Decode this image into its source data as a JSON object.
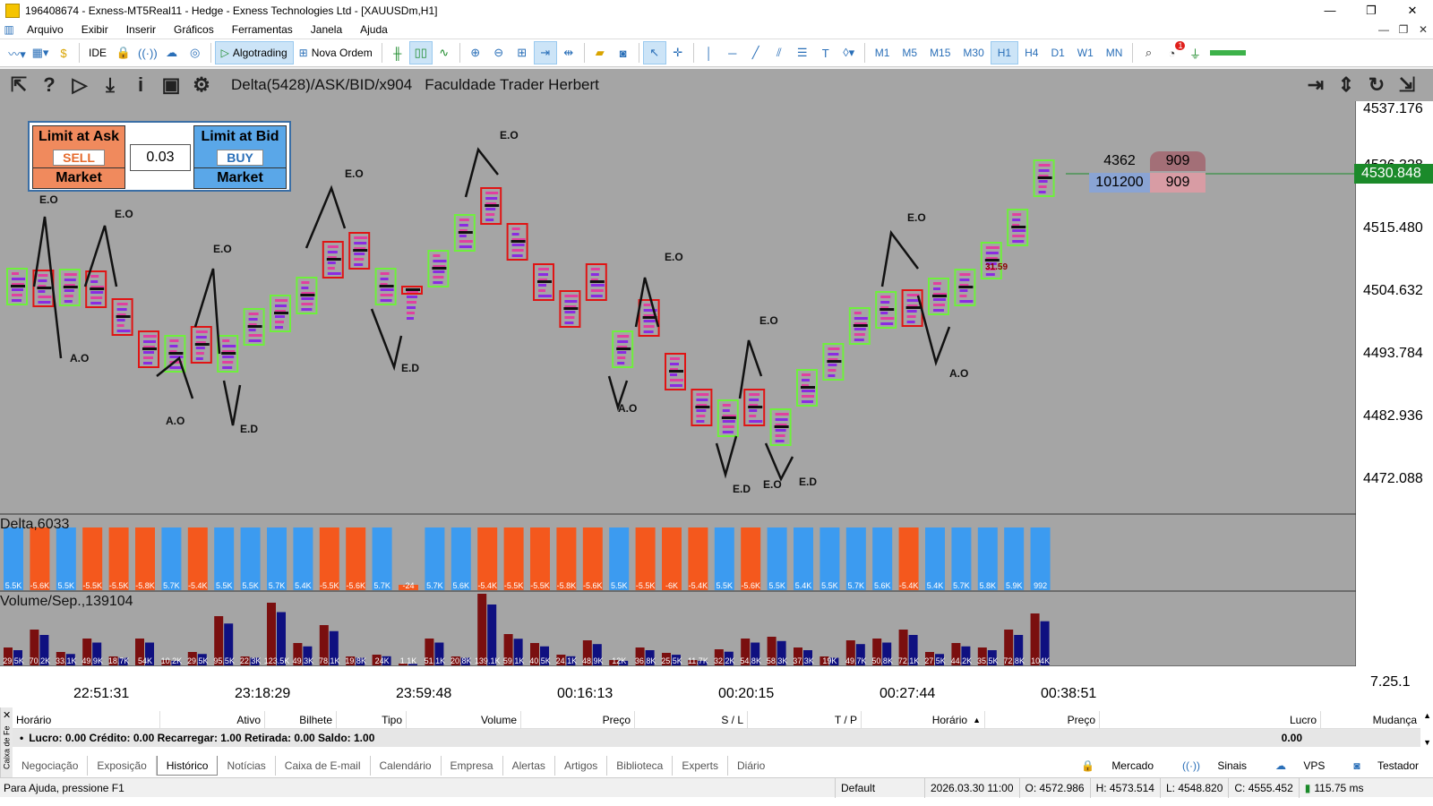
{
  "window": {
    "title": "196408674 - Exness-MT5Real11 - Hedge - Exness Technologies Ltd - [XAUUSDm,H1]",
    "controls": [
      "—",
      "❐",
      "✕"
    ]
  },
  "menu": {
    "items": [
      "Arquivo",
      "Exibir",
      "Inserir",
      "Gráficos",
      "Ferramentas",
      "Janela",
      "Ajuda"
    ]
  },
  "toolbar": {
    "ide": "IDE",
    "algotrading": "Algotrading",
    "nova_ordem": "Nova Ordem",
    "timeframes": [
      "M1",
      "M5",
      "M15",
      "M30",
      "H1",
      "H4",
      "D1",
      "W1",
      "MN"
    ],
    "active_timeframe": "H1",
    "notification_count": "1"
  },
  "chart": {
    "indicator_label": "Delta(5428)/ASK/BID/x904",
    "channel_label": "Faculdade Trader Herbert",
    "trade_panel": {
      "limit_ask": "Limit at Ask",
      "sell": "SELL",
      "market_left": "Market",
      "lot": "0.03",
      "limit_bid": "Limit at Bid",
      "buy": "BUY",
      "market_right": "Market"
    },
    "price_levels": [
      "4537.176",
      "4526.328",
      "4515.480",
      "4504.632",
      "4493.784",
      "4482.936",
      "4472.088"
    ],
    "current_price": "4530.848",
    "volume_info": {
      "top_left": "4362",
      "top_right": "909",
      "bottom_left": "101200",
      "bottom_right": "909"
    },
    "time_labels": [
      "22:51:31",
      "23:18:29",
      "23:59:48",
      "00:16:13",
      "00:20:15",
      "00:27:44",
      "00:38:51"
    ],
    "annotation_value": "31.59",
    "pattern_labels": [
      "E.O",
      "A.O",
      "E.D"
    ],
    "delta_panel_label": "Delta,6033",
    "volume_panel_label": "Volume/Sep.,139104",
    "volume_axis_value": "7.25.1",
    "delta_values": [
      "5.5K",
      "-5.6K",
      "5.5K",
      "-5.5K",
      "-5.5K",
      "-5.8K",
      "5.7K",
      "-5.4K",
      "5.5K",
      "5.5K",
      "5.7K",
      "5.4K",
      "-5.5K",
      "-5.6K",
      "5.7K",
      "-24",
      "5.7K",
      "5.6K",
      "-5.4K",
      "-5.5K",
      "-5.5K",
      "-5.8K",
      "-5.6K",
      "5.5K",
      "-5.5K",
      "-6K",
      "-5.4K",
      "5.5K",
      "-5.6K",
      "5.5K",
      "5.4K",
      "5.5K",
      "5.7K",
      "5.6K",
      "-5.4K",
      "5.4K",
      "5.7K",
      "5.8K",
      "5.9K",
      "992"
    ],
    "volume_values": [
      "29.5K",
      "70.2K",
      "33.1K",
      "49.9K",
      "18.7K",
      "54K",
      "10.2K",
      "29.5K",
      "95.5K",
      "22.3K",
      "123.5K",
      "49.3K",
      "78.1K",
      "19.8K",
      "24K",
      "1.1K",
      "51.1K",
      "20.8K",
      "139.1K",
      "59.1K",
      "40.5K",
      "24.1K",
      "48.9K",
      "12K",
      "36.8K",
      "25.5K",
      "11.7K",
      "32.2K",
      "54.8K",
      "58.3K",
      "37.3K",
      "19K",
      "49.7K",
      "50.8K",
      "72.1K",
      "27.5K",
      "44.2K",
      "35.5K",
      "72.8K",
      "104K"
    ]
  },
  "toolbox": {
    "side_label": "Caixa de Fe",
    "columns": [
      "Horário",
      "Ativo",
      "Bilhete",
      "Tipo",
      "Volume",
      "Preço",
      "S / L",
      "T / P",
      "Horário",
      "Preço",
      "Lucro",
      "Mudança"
    ],
    "summary": "Lucro: 0.00  Crédito: 0.00  Recarregar: 1.00  Retirada: 0.00  Saldo: 1.00",
    "summary_value": "0.00",
    "tabs": [
      "Negociação",
      "Exposição",
      "Histórico",
      "Notícias",
      "Caixa de E-mail",
      "Calendário",
      "Empresa",
      "Alertas",
      "Artigos",
      "Biblioteca",
      "Experts",
      "Diário"
    ],
    "active_tab": "Histórico",
    "right_items": [
      "Mercado",
      "Sinais",
      "VPS",
      "Testador"
    ]
  },
  "statusbar": {
    "help": "Para Ajuda, pressione F1",
    "profile": "Default",
    "datetime": "2026.03.30 11:00",
    "open": "O: 4572.986",
    "high": "H: 4573.514",
    "low": "L: 4548.820",
    "close": "C: 4555.452",
    "ping": "115.75 ms"
  },
  "colors": {
    "chart_bg": "#a5a5a5",
    "bull": "#3c9bf0",
    "bear": "#f4581d",
    "price_tag": "#1b8a2a",
    "vol_red": "#7a0f0f",
    "vol_blue": "#0f1080"
  }
}
